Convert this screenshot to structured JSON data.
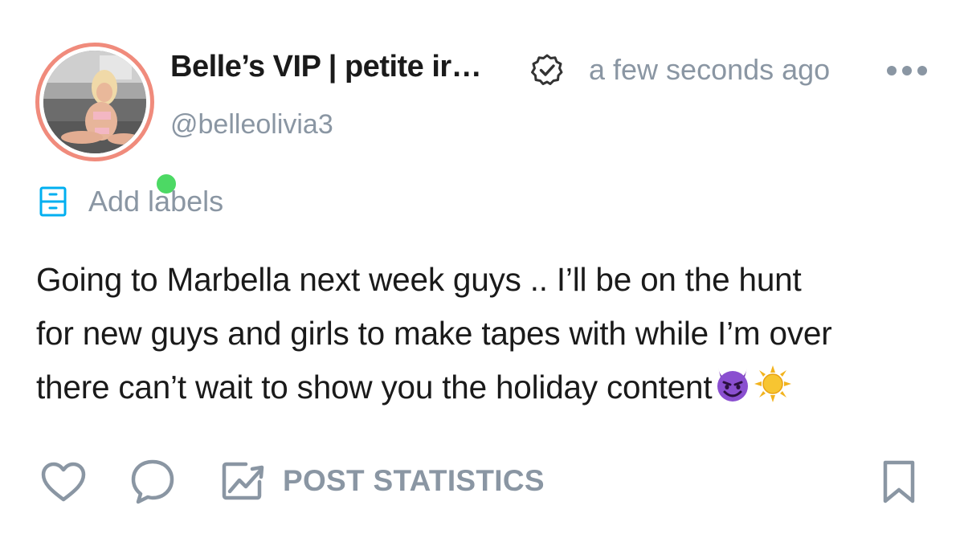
{
  "post": {
    "author": {
      "display_name": "Belle’s VIP | petite ir…",
      "username": "@belleolivia3",
      "verified_icon": "verified-badge-icon",
      "online_status": "online",
      "online_color": "#4cd964",
      "ring_color": "#f08b7c"
    },
    "timestamp": "a few seconds ago",
    "more_icon": "more-dots-icon",
    "labels": {
      "icon": "labels-icon",
      "text": "Add labels"
    },
    "body": {
      "lines": [
        "Going to Marbella next week guys .. I’ll be on the hunt",
        "for new guys and girls to make tapes with while I’m over",
        "there can’t wait to show you the holiday content"
      ],
      "trailing_emojis": [
        "smiling-devil-emoji",
        "sun-emoji"
      ]
    },
    "actions": {
      "like_icon": "heart-icon",
      "comment_icon": "comment-icon",
      "stats_icon": "chart-icon",
      "stats_label": "POST STATISTICS",
      "bookmark_icon": "bookmark-icon"
    },
    "colors": {
      "text_primary": "#1a1a1a",
      "text_muted": "#8a96a3",
      "accent_blue": "#00aff0"
    }
  }
}
